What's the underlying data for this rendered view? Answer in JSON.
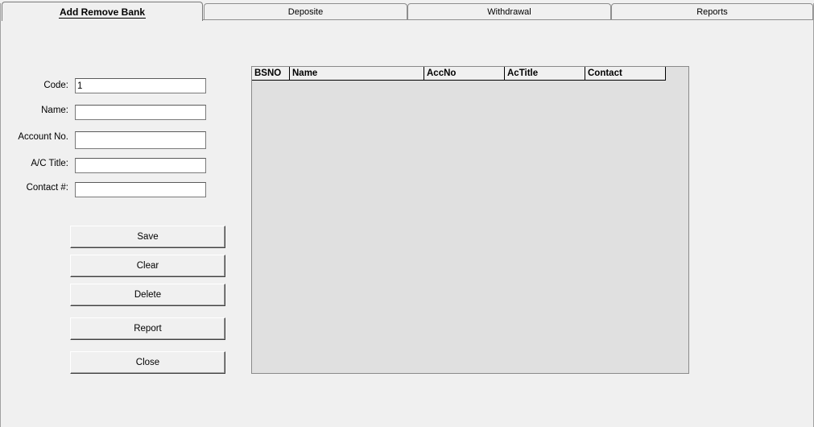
{
  "tabs": [
    {
      "label": "Add Remove Bank",
      "active": true
    },
    {
      "label": "Deposite",
      "active": false
    },
    {
      "label": "Withdrawal",
      "active": false
    },
    {
      "label": "Reports",
      "active": false
    }
  ],
  "form": {
    "code_label": "Code:",
    "code_value": "1",
    "name_label": "Name:",
    "name_value": "",
    "account_label": "Account No.",
    "account_value": "",
    "title_label": "A/C Title:",
    "title_value": "",
    "contact_label": "Contact #:",
    "contact_value": ""
  },
  "buttons": {
    "save": "Save",
    "clear": "Clear",
    "delete": "Delete",
    "report": "Report",
    "close": "Close"
  },
  "grid": {
    "columns": [
      "BSNO",
      "Name",
      "AccNo",
      "AcTitle",
      "Contact"
    ],
    "rows": []
  }
}
